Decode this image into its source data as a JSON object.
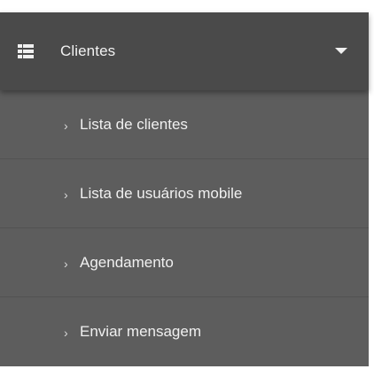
{
  "menu": {
    "header": {
      "icon": "list-icon",
      "title": "Clientes",
      "toggle_icon": "caret-down-icon"
    },
    "items": [
      {
        "chevron": "›",
        "label": "Lista de clientes"
      },
      {
        "chevron": "›",
        "label": "Lista de usuários mobile"
      },
      {
        "chevron": "›",
        "label": "Agendamento"
      },
      {
        "chevron": "›",
        "label": "Enviar mensagem"
      }
    ]
  },
  "colors": {
    "header_bg": "#4a4a4a",
    "submenu_bg": "#5d5d5d",
    "text": "#f0f0f0"
  }
}
